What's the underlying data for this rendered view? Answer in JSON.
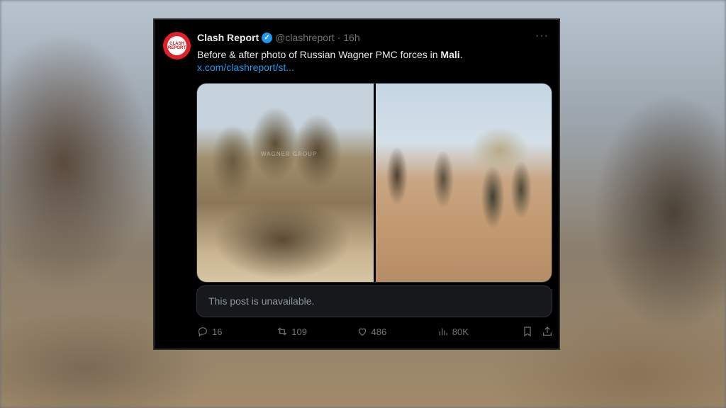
{
  "tweet": {
    "name": "Clash Report",
    "handle": "@clashreport",
    "dot": "·",
    "time": "16h",
    "more": "···",
    "text_prefix": "Before & after photo of Russian Wagner PMC forces in ",
    "text_bold": "Mali",
    "text_suffix": ".",
    "link": "x.com/clashreport/st...",
    "avatar_text": "CLASH REPORT",
    "watermark": "WAGNER GROUP",
    "unavailable_text": "This post is unavailable."
  },
  "actions": {
    "replies": "16",
    "retweets": "109",
    "likes": "486",
    "views": "80K"
  },
  "icons": {
    "reply": "reply-icon",
    "retweet": "retweet-icon",
    "like": "heart-icon",
    "views": "views-icon",
    "bookmark": "bookmark-icon",
    "share": "share-icon",
    "verified": "verified-badge-icon"
  },
  "colors": {
    "background": "#000000",
    "text": "#e7e9ea",
    "muted": "#71767b",
    "link": "#1d9bf0",
    "avatar": "#e0202a"
  }
}
